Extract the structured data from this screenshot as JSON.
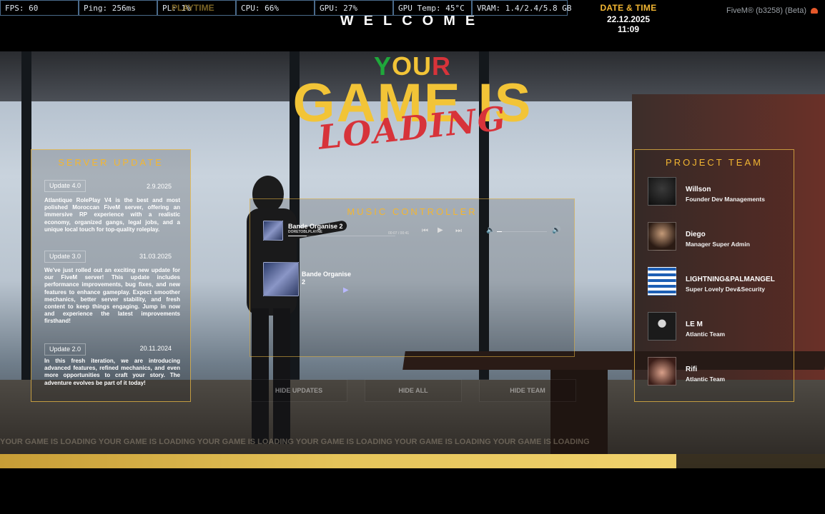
{
  "stats": {
    "fps": "FPS: 60",
    "ping": "Ping: 256ms",
    "pl": "PL: 1%",
    "cpu": "CPU: 66%",
    "gpu": "GPU: 27%",
    "gpu_temp": "GPU Temp: 45°C",
    "vram": "VRAM: 1.4/2.4/5.8 GB"
  },
  "ghost_label": "PLAYTIME",
  "datetime": {
    "title": "DATE & TIME",
    "value": "22.12.2025 11:09"
  },
  "app_version": "FiveM® (b3258) (Beta)",
  "welcome": "WELCOME",
  "hero": {
    "your": [
      "Y",
      "OU",
      "R"
    ],
    "game_is": "GAME IS",
    "loading": "LOADING"
  },
  "server_update": {
    "title": "SERVER UPDATE",
    "updates": [
      {
        "version": "Update 4.0",
        "date": "2.9.2025",
        "text": "Atlantique RolePlay V4 is the best and most polished Moroccan FiveM server, offering an immersive RP experience with a realistic economy, organized gangs, legal jobs, and a unique local touch for top-quality roleplay."
      },
      {
        "version": "Update 3.0",
        "date": "31.03.2025",
        "text": "We've just rolled out an exciting new update for our FiveM server! This update includes performance improvements, bug fixes, and new features to enhance gameplay. Expect smoother mechanics, better server stability, and fresh content to keep things engaging. Jump in now and experience the latest improvements firsthand!"
      },
      {
        "version": "Update 2.0",
        "date": "20.11.2024",
        "text": "In this fresh iteration, we are introducing advanced features, refined mechanics, and even more opportunities to craft your story. The adventure evolves be part of it today!"
      }
    ]
  },
  "music": {
    "title": "MUSIC CONTROLLER",
    "now_playing": {
      "title": "Bande Organise 2",
      "artist": "DORETOBLPLAYNE",
      "time": "00:07 / 00:41"
    },
    "playlist": [
      {
        "title": "Bande Organise 2"
      }
    ],
    "progress": 0.17,
    "volume": 0.1
  },
  "project_team": {
    "title": "PROJECT TEAM",
    "members": [
      {
        "name": "Willson",
        "role": "Founder Dev Managements"
      },
      {
        "name": "Diego",
        "role": "Manager Super Admin"
      },
      {
        "name": "LIGHTNING&PALMANGEL",
        "role": "Super Lovely Dev&Security"
      },
      {
        "name": "LE M",
        "role": "Atlantic Team"
      },
      {
        "name": "Rifi",
        "role": "Atlantic Team"
      }
    ]
  },
  "buttons": {
    "hide_updates": "HIDE UPDATES",
    "hide_all": "HIDE ALL",
    "hide_team": "HIDE TEAM"
  },
  "marquee": "YOUR GAME IS LOADING YOUR GAME IS LOADING YOUR GAME IS LOADING YOUR GAME IS LOADING YOUR GAME IS LOADING YOUR GAME IS LOADING",
  "loading_progress": 0.82,
  "colors": {
    "accent": "#f2b632",
    "red": "#d7333a",
    "green": "#1fa83b"
  }
}
